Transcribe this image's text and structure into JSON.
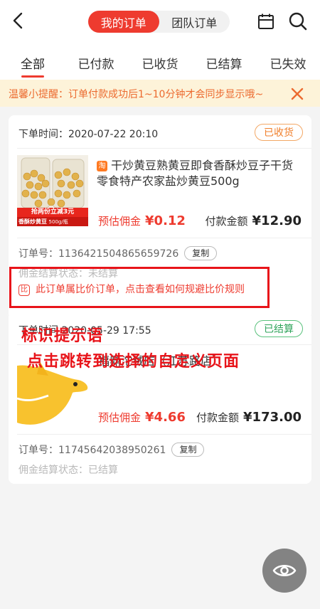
{
  "header": {
    "segments": [
      "我的订单",
      "团队订单"
    ]
  },
  "tabs": [
    "全部",
    "已付款",
    "已收货",
    "已结算",
    "已失效"
  ],
  "notice": {
    "text": "温馨小提醒：订单付款成功后1~10分钟才会同步显示哦~"
  },
  "orders": [
    {
      "time_label": "下单时间：",
      "time": "2020-07-22 20:10",
      "status": "已收货",
      "platform_badge": "淘",
      "title": "干炒黄豆熟黄豆即食香酥炒豆子干货零食特产农家盐炒黄豆500g",
      "image_caption_top": "抢两份立减3元",
      "image_caption_bottom": "香酥炒黄豆",
      "image_caption_weight": "500g/瓶",
      "commission_label": "预估佣金",
      "commission": "¥0.12",
      "pay_label": "付款金额",
      "pay_amount": "¥12.90",
      "order_no_label": "订单号：",
      "order_no": "1136421504865659726",
      "copy_label": "复制",
      "settle_label": "佣金结算状态：",
      "settle_status": "未结算",
      "compare_icon": "比",
      "compare_text": "此订单属比价订单，点击查看如何规避比价规则"
    },
    {
      "time_label": "下单时间",
      "time": "2020-05-29 17:55",
      "status": "已结算",
      "store": "福鼎沱绒店（江苏路店）",
      "commission_label": "预估佣金",
      "commission": "¥4.66",
      "pay_label": "付款金额",
      "pay_amount": "¥173.00",
      "order_no_label": "订单号：",
      "order_no": "11745642038950261",
      "copy_label": "复制",
      "settle_label": "佣金结算状态：",
      "settle_status": "已结算"
    }
  ],
  "annotation": {
    "line1": "标识提示语",
    "line2": "点击跳转到选择的自定义页面"
  },
  "colors": {
    "accent": "#ee3b2f",
    "notice_bg": "#fdf3d9",
    "notice_text": "#ec6a2f",
    "status_orange": "#f07f2b",
    "status_green": "#2ea35a",
    "annotation_red": "#e8141a"
  }
}
